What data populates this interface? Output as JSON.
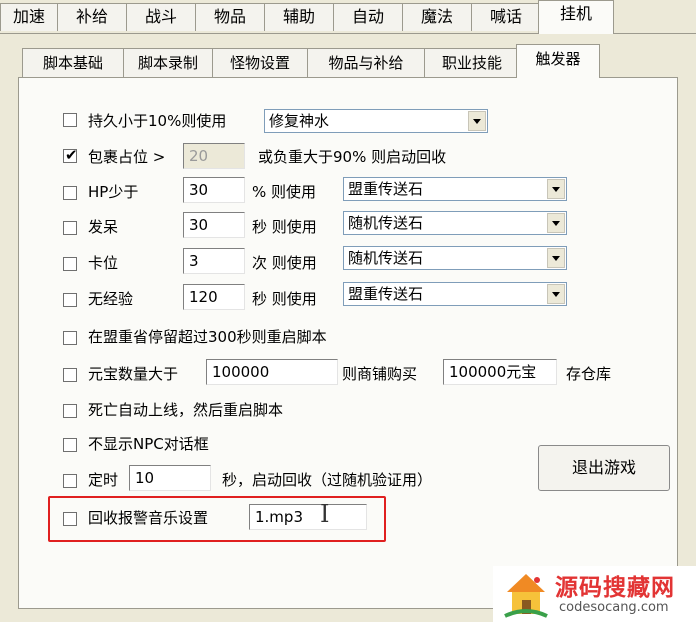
{
  "main_tabs": [
    {
      "label": "加速"
    },
    {
      "label": "补给"
    },
    {
      "label": "战斗"
    },
    {
      "label": "物品"
    },
    {
      "label": "辅助"
    },
    {
      "label": "自动"
    },
    {
      "label": "魔法"
    },
    {
      "label": "喊话"
    },
    {
      "label": "挂机",
      "active": true
    }
  ],
  "sub_tabs": [
    {
      "label": "脚本基础"
    },
    {
      "label": "脚本录制"
    },
    {
      "label": "怪物设置"
    },
    {
      "label": "物品与补给"
    },
    {
      "label": "职业技能"
    },
    {
      "label": "触发器",
      "active": true
    }
  ],
  "triggers": {
    "durability": {
      "checked": false,
      "label": "持久小于10%则使用",
      "item": "修复神水"
    },
    "bag": {
      "checked": true,
      "label": "包裹占位 >",
      "value": "20",
      "suffix": "或负重大于90% 则启动回收"
    },
    "hp": {
      "checked": false,
      "label": "HP少于",
      "value": "30",
      "unit": "% 则使用",
      "item": "盟重传送石"
    },
    "idle": {
      "checked": false,
      "label": "发呆",
      "value": "30",
      "unit": "秒 则使用",
      "item": "随机传送石"
    },
    "stuck": {
      "checked": false,
      "label": "卡位",
      "value": "3",
      "unit": "次 则使用",
      "item": "随机传送石"
    },
    "noexp": {
      "checked": false,
      "label": "无经验",
      "value": "120",
      "unit": "秒 则使用",
      "item": "盟重传送石"
    },
    "mengzhong": {
      "checked": false,
      "label": "在盟重省停留超过300秒则重启脚本"
    },
    "yuanbao": {
      "checked": false,
      "label": "元宝数量大于",
      "value": "100000",
      "mid": "则商铺购买",
      "value2": "100000元宝",
      "suffix": "存仓库"
    },
    "death": {
      "checked": false,
      "label": "死亡自动上线，然后重启脚本"
    },
    "npc": {
      "checked": false,
      "label": "不显示NPC对话框"
    },
    "timer": {
      "checked": false,
      "label": "定时",
      "value": "10",
      "suffix": "秒，启动回收（过随机验证用）"
    },
    "alarm": {
      "checked": false,
      "label": "回收报警音乐设置",
      "value": "1.mp3"
    }
  },
  "exit_button": "退出游戏",
  "watermark": {
    "name": "源码搜藏网",
    "url": "codesocang.com"
  },
  "colors": {
    "highlight_border": "#e02020",
    "watermark_text": "#e23434"
  }
}
